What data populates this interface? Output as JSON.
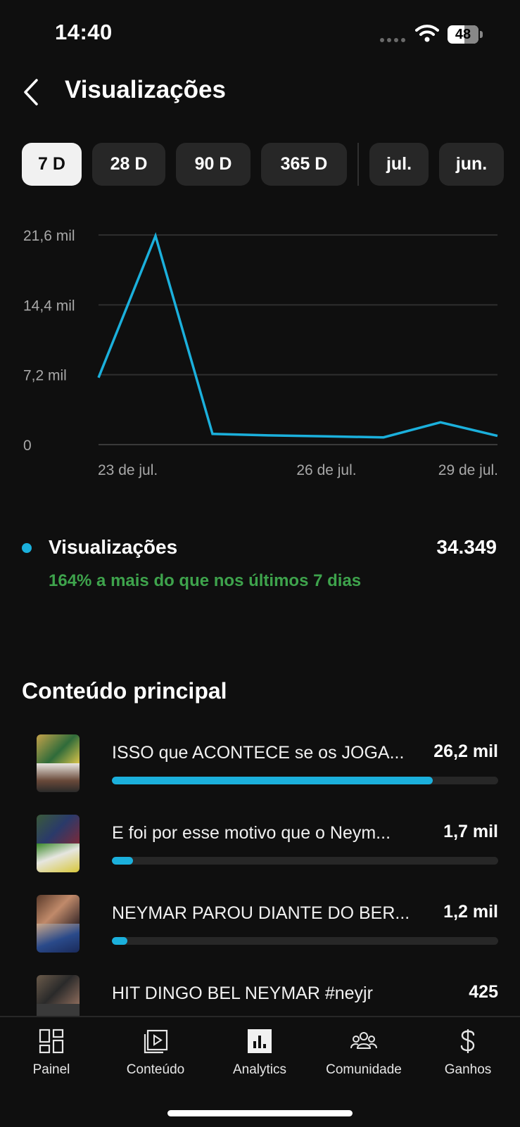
{
  "status_bar": {
    "time": "14:40",
    "battery": "48"
  },
  "header": {
    "title": "Visualizações"
  },
  "ranges": [
    {
      "label": "7 D",
      "active": true
    },
    {
      "label": "28 D",
      "active": false
    },
    {
      "label": "90 D",
      "active": false
    },
    {
      "label": "365 D",
      "active": false
    },
    {
      "label": "jul.",
      "active": false
    },
    {
      "label": "jun.",
      "active": false
    }
  ],
  "chart_data": {
    "type": "line",
    "y_tick_labels": [
      "0",
      "7,2 mil",
      "14,4 mil",
      "21,6 mil"
    ],
    "y_tick_values": [
      0,
      7200,
      14400,
      21600
    ],
    "ylim": [
      0,
      21600
    ],
    "x_tick_labels": [
      "23 de jul.",
      "26 de jul.",
      "29 de jul."
    ],
    "x": [
      "22 de jul.",
      "23 de jul.",
      "24 de jul.",
      "25 de jul.",
      "26 de jul.",
      "27 de jul.",
      "28 de jul.",
      "29 de jul."
    ],
    "series": [
      {
        "values": [
          6900,
          21500,
          1100,
          950,
          850,
          750,
          2300,
          900
        ]
      }
    ],
    "grid": true,
    "colors": {
      "line": "#1bb0dc",
      "grid": "#2e2e2e",
      "tick": "#a8a8a8"
    }
  },
  "summary": {
    "label": "Visualizações",
    "value": "34.349",
    "comparison": "164% a mais do que nos últimos 7 dias"
  },
  "section_title": "Conteúdo principal",
  "content": [
    {
      "title": "ISSO que ACONTECE se os JOGA...",
      "views": "26,2 mil",
      "share": 0.83
    },
    {
      "title": "E foi por esse motivo que o Neym...",
      "views": "1,7 mil",
      "share": 0.055
    },
    {
      "title": "NEYMAR PAROU DIANTE DO BER...",
      "views": "1,2 mil",
      "share": 0.04
    },
    {
      "title": "HIT DINGO BEL NEYMAR #neyjr",
      "views": "425",
      "share": 0.016
    }
  ],
  "nav": [
    {
      "label": "Painel",
      "icon": "dashboard-icon"
    },
    {
      "label": "Conteúdo",
      "icon": "content-icon"
    },
    {
      "label": "Analytics",
      "icon": "analytics-icon"
    },
    {
      "label": "Comunidade",
      "icon": "community-icon"
    },
    {
      "label": "Ganhos",
      "icon": "earnings-icon"
    }
  ],
  "colors": {
    "accent": "#1bb0dc",
    "positive": "#3ea34c",
    "background": "#0f0f0f"
  }
}
